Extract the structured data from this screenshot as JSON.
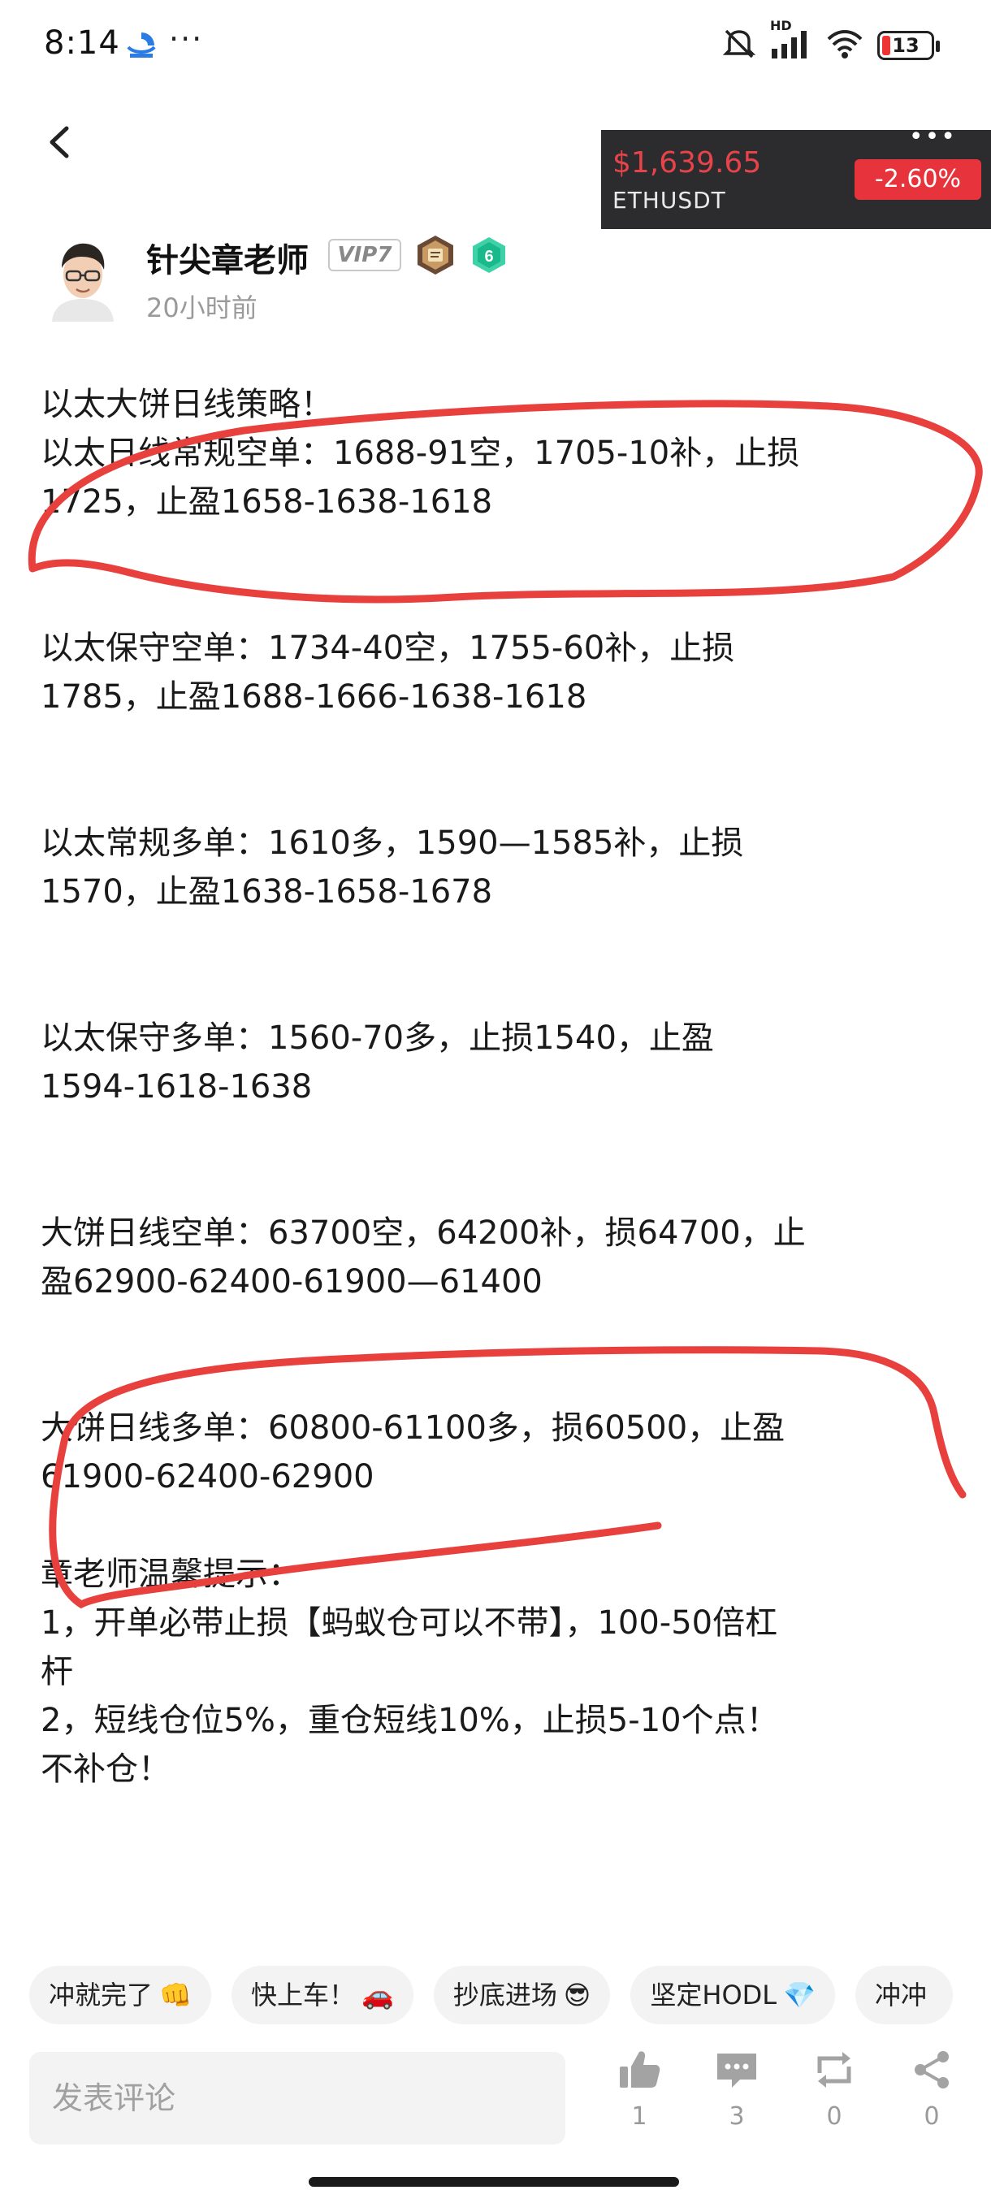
{
  "status_bar": {
    "time": "8:14",
    "more_dots": "···",
    "network_label": "HD",
    "battery_level": "13"
  },
  "ticker": {
    "price": "$1,639.65",
    "symbol": "ETHUSDT",
    "change": "-2.60%",
    "menu_dots": "•••",
    "price_color": "#e7434a",
    "change_bg": "#e7343c"
  },
  "author": {
    "name": "针尖章老师",
    "vip": "VIP7",
    "level": "6",
    "time_ago": "20小时前"
  },
  "post": {
    "lines": [
      "以太大饼日线策略！",
      "以太日线常规空单：1688-91空，1705-10补，止损",
      "1725，止盈1658-1638-1618",
      "以太保守空单：1734-40空，1755-60补，止损",
      "1785，止盈1688-1666-1638-1618",
      "以太常规多单：1610多，1590—1585补，止损",
      "1570，止盈1638-1658-1678",
      "以太保守多单：1560-70多，止损1540，止盈",
      "1594-1618-1638",
      "大饼日线空单：63700空，64200补，损64700，止",
      "盈62900-62400-61900—61400",
      "大饼日线多单：60800-61100多，损60500，止盈",
      "61900-62400-62900",
      "章老师温馨提示：",
      "1，开单必带止损【蚂蚁仓可以不带】，100-50倍杠",
      "杆",
      "2，短线仓位5%，重仓短线10%，止损5-10个点！",
      "不补仓！"
    ],
    "annotation_color": "#e8403d"
  },
  "reactions": [
    {
      "label": "冲就完了",
      "emoji": "👊"
    },
    {
      "label": "快上车！",
      "emoji": "🚗"
    },
    {
      "label": "抄底进场",
      "emoji": "😎"
    },
    {
      "label": "坚定HODL",
      "emoji": "💎"
    },
    {
      "label": "冲冲",
      "emoji": ""
    }
  ],
  "bottom_bar": {
    "comment_placeholder": "发表评论",
    "like_count": "1",
    "comment_count": "3",
    "repost_count": "0",
    "share_count": "0"
  }
}
